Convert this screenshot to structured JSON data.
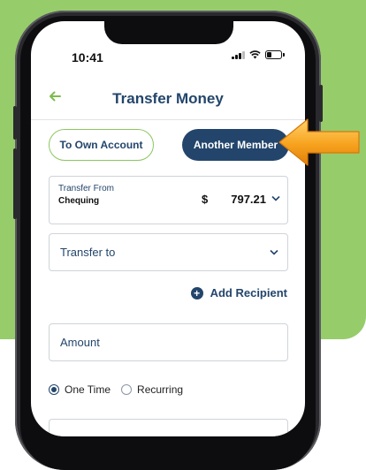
{
  "status_bar": {
    "time": "10:41"
  },
  "header": {
    "title": "Transfer Money"
  },
  "transfer_type": {
    "own_account_label": "To Own Account",
    "another_member_label": "Another Member",
    "selected": "Another Member"
  },
  "transfer_from": {
    "label": "Transfer From",
    "account": "Chequing",
    "currency": "$",
    "balance": "797.21"
  },
  "transfer_to": {
    "placeholder": "Transfer to"
  },
  "add_recipient": {
    "label": "Add Recipient"
  },
  "amount": {
    "placeholder": "Amount"
  },
  "frequency": {
    "options": [
      "One Time",
      "Recurring"
    ],
    "selected": "One Time"
  },
  "colors": {
    "primary": "#23456b",
    "accent_green": "#8cc660",
    "background_green": "#97cc6b",
    "pointer_orange": "#f5a623"
  }
}
